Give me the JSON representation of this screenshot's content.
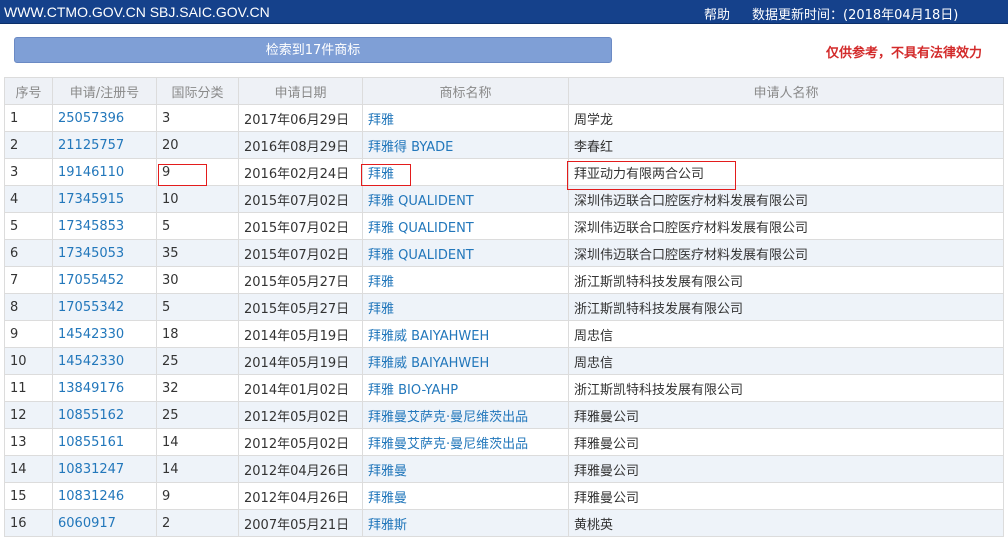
{
  "header": {
    "site": "WWW.CTMO.GOV.CN SBJ.SAIC.GOV.CN",
    "help": "帮助",
    "update_label": "数据更新时间：(2018年04月18日)"
  },
  "search_summary": "检索到17件商标",
  "disclaimer": "仅供参考，不具有法律效力",
  "table": {
    "headers": [
      "序号",
      "申请/注册号",
      "国际分类",
      "申请日期",
      "商标名称",
      "申请人名称"
    ],
    "rows": [
      {
        "no": "1",
        "reg": "25057396",
        "cls": "3",
        "date": "2017年06月29日",
        "mark": "拜雅",
        "applicant": "周学龙"
      },
      {
        "no": "2",
        "reg": "21125757",
        "cls": "20",
        "date": "2016年08月29日",
        "mark": "拜雅得 BYADE",
        "applicant": "李春红"
      },
      {
        "no": "3",
        "reg": "19146110",
        "cls": "9",
        "date": "2016年02月24日",
        "mark": "拜雅",
        "applicant": "拜亚动力有限两合公司"
      },
      {
        "no": "4",
        "reg": "17345915",
        "cls": "10",
        "date": "2015年07月02日",
        "mark": "拜雅 QUALIDENT",
        "applicant": "深圳伟迈联合口腔医疗材料发展有限公司"
      },
      {
        "no": "5",
        "reg": "17345853",
        "cls": "5",
        "date": "2015年07月02日",
        "mark": "拜雅 QUALIDENT",
        "applicant": "深圳伟迈联合口腔医疗材料发展有限公司"
      },
      {
        "no": "6",
        "reg": "17345053",
        "cls": "35",
        "date": "2015年07月02日",
        "mark": "拜雅 QUALIDENT",
        "applicant": "深圳伟迈联合口腔医疗材料发展有限公司"
      },
      {
        "no": "7",
        "reg": "17055452",
        "cls": "30",
        "date": "2015年05月27日",
        "mark": "拜雅",
        "applicant": "浙江斯凯特科技发展有限公司"
      },
      {
        "no": "8",
        "reg": "17055342",
        "cls": "5",
        "date": "2015年05月27日",
        "mark": "拜雅",
        "applicant": "浙江斯凯特科技发展有限公司"
      },
      {
        "no": "9",
        "reg": "14542330",
        "cls": "18",
        "date": "2014年05月19日",
        "mark": "拜雅威 BAIYAHWEH",
        "applicant": "周忠信"
      },
      {
        "no": "10",
        "reg": "14542330",
        "cls": "25",
        "date": "2014年05月19日",
        "mark": "拜雅威 BAIYAHWEH",
        "applicant": "周忠信"
      },
      {
        "no": "11",
        "reg": "13849176",
        "cls": "32",
        "date": "2014年01月02日",
        "mark": "拜雅 BIO-YAHP",
        "applicant": "浙江斯凯特科技发展有限公司"
      },
      {
        "no": "12",
        "reg": "10855162",
        "cls": "25",
        "date": "2012年05月02日",
        "mark": "拜雅曼艾萨克·曼尼维茨出品",
        "applicant": "拜雅曼公司"
      },
      {
        "no": "13",
        "reg": "10855161",
        "cls": "14",
        "date": "2012年05月02日",
        "mark": "拜雅曼艾萨克·曼尼维茨出品",
        "applicant": "拜雅曼公司"
      },
      {
        "no": "14",
        "reg": "10831247",
        "cls": "14",
        "date": "2012年04月26日",
        "mark": "拜雅曼",
        "applicant": "拜雅曼公司"
      },
      {
        "no": "15",
        "reg": "10831246",
        "cls": "9",
        "date": "2012年04月26日",
        "mark": "拜雅曼",
        "applicant": "拜雅曼公司"
      },
      {
        "no": "16",
        "reg": "6060917",
        "cls": "2",
        "date": "2007年05月21日",
        "mark": "拜雅斯",
        "applicant": "黄桃英"
      }
    ]
  }
}
